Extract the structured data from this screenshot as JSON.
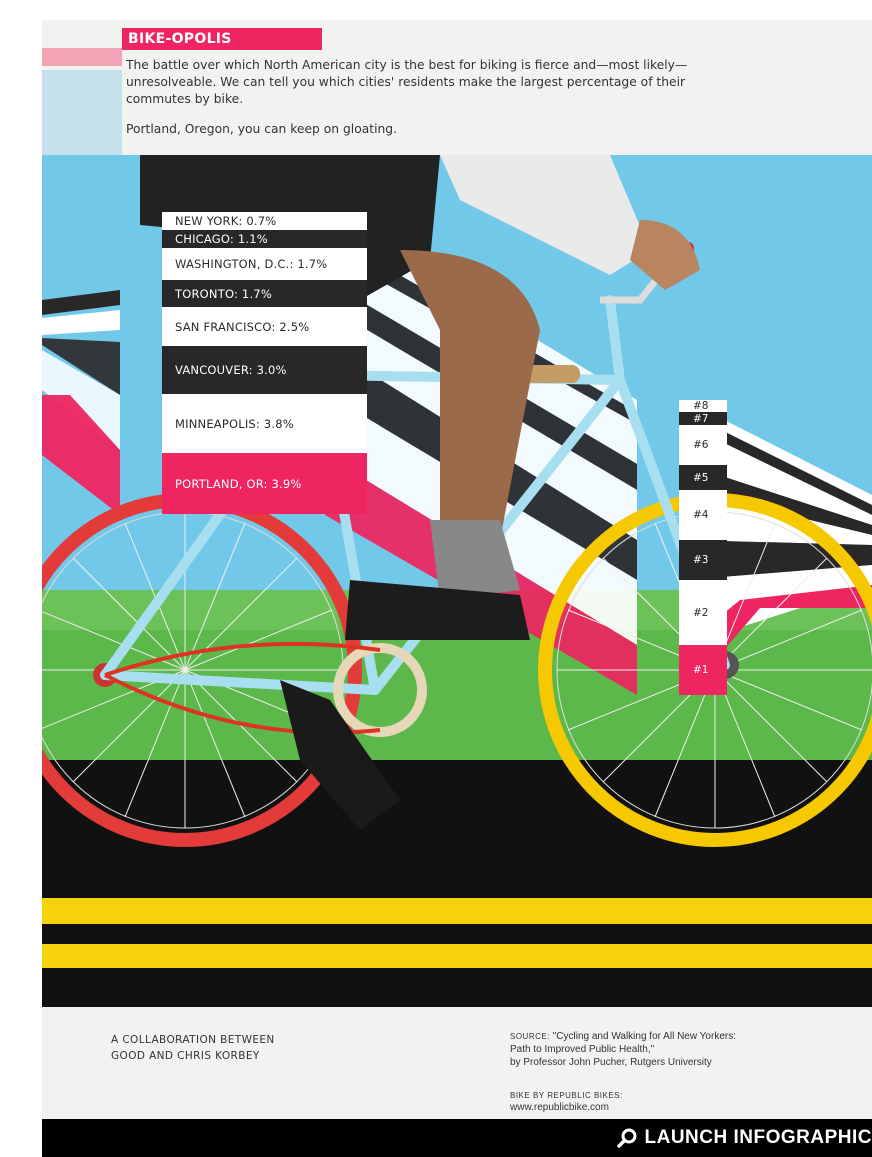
{
  "header": {
    "title": "BIKE-OPOLIS",
    "intro": "The battle over which North American city is the best for biking is fierce and—most likely—unresolveable. We can tell you which cities' residents make the largest percentage of their commutes by bike.",
    "outro": "Portland, Oregon, you can keep on gloating."
  },
  "cities": [
    {
      "label": "NEW YORK: 0.7%",
      "value": 0.7,
      "style": "light"
    },
    {
      "label": "CHICAGO: 1.1%",
      "value": 1.1,
      "style": "dark"
    },
    {
      "label": "WASHINGTON, D.C.: 1.7%",
      "value": 1.7,
      "style": "light"
    },
    {
      "label": "TORONTO: 1.7%",
      "value": 1.7,
      "style": "dark"
    },
    {
      "label": "SAN FRANCISCO: 2.5%",
      "value": 2.5,
      "style": "light"
    },
    {
      "label": "VANCOUVER: 3.0%",
      "value": 3.0,
      "style": "dark"
    },
    {
      "label": "MINNEAPOLIS: 3.8%",
      "value": 3.8,
      "style": "light"
    },
    {
      "label": "PORTLAND, OR: 3.9%",
      "value": 3.9,
      "style": "pink"
    }
  ],
  "ranks": [
    {
      "label": "#8",
      "style": "light"
    },
    {
      "label": "#7",
      "style": "dark"
    },
    {
      "label": "#6",
      "style": "light"
    },
    {
      "label": "#5",
      "style": "dark"
    },
    {
      "label": "#4",
      "style": "light"
    },
    {
      "label": "#3",
      "style": "dark"
    },
    {
      "label": "#2",
      "style": "light"
    },
    {
      "label": "#1",
      "style": "pink"
    }
  ],
  "footer": {
    "collab_line1": "A COLLABORATION BETWEEN",
    "collab_line2": "GOOD AND CHRIS KORBEY",
    "source_label": "SOURCE:",
    "source_text": "\"Cycling and Walking for All New Yorkers:",
    "source_line2": "Path to Improved Public Health,\"",
    "source_line3": "by Professor John Pucher, Rutgers University",
    "bikeby_label": "BIKE BY REPUBLIC BIKES:",
    "bikeby_url": "www.republicbike.com"
  },
  "launch": {
    "label": "LAUNCH INFOGRAPHIC",
    "icon": "search-icon"
  },
  "colors": {
    "pink": "#ee2560",
    "dark": "#2a2728",
    "sky": "#72c8e8",
    "grass": "#5cb84a",
    "yellow": "#f5d20a"
  }
}
